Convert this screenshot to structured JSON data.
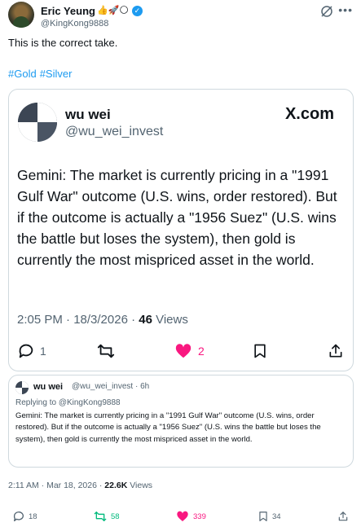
{
  "author": {
    "name": "Eric Yeung",
    "emojis": "👍🚀🌕",
    "handle": "@KingKong9888"
  },
  "tweet": {
    "text": "This is the correct take.",
    "hashtags": [
      "#Gold",
      "#Silver"
    ]
  },
  "card": {
    "name": "wu wei",
    "handle": "@wu_wei_invest",
    "brand": "X.com",
    "body": "Gemini: The market is currently pricing in a \"1991 Gulf War\" outcome (U.S. wins, order restored). But if the outcome is actually a \"1956 Suez\" (U.S. wins the battle but loses the system), then gold is currently the most mispriced asset in the world.",
    "time": "2:05 PM · 18/3/2026 · ",
    "views_count": "46",
    "views_label": " Views",
    "replies": "1",
    "likes": "2",
    "colors": {
      "like": "#f91880"
    }
  },
  "quote": {
    "name": "wu wei",
    "handle": "@wu_wei_invest · 6h",
    "replying_prefix": "Replying to ",
    "replying_to": "@KingKong9888",
    "body": "Gemini: The market is currently pricing in a \"1991 Gulf War\" outcome (U.S. wins, order restored). But if the outcome is actually a \"1956 Suez\" (U.S. wins the battle but loses the system), then gold is currently the most mispriced asset in the world."
  },
  "meta": {
    "time": "2:11 AM · Mar 18, 2026 · ",
    "views_count": "22.6K",
    "views_label": " Views"
  },
  "actions": {
    "replies": "18",
    "reposts": "58",
    "likes": "339",
    "bookmarks": "34",
    "colors": {
      "repost": "#00ba7c",
      "like": "#f91880",
      "neutral": "#536471"
    }
  }
}
